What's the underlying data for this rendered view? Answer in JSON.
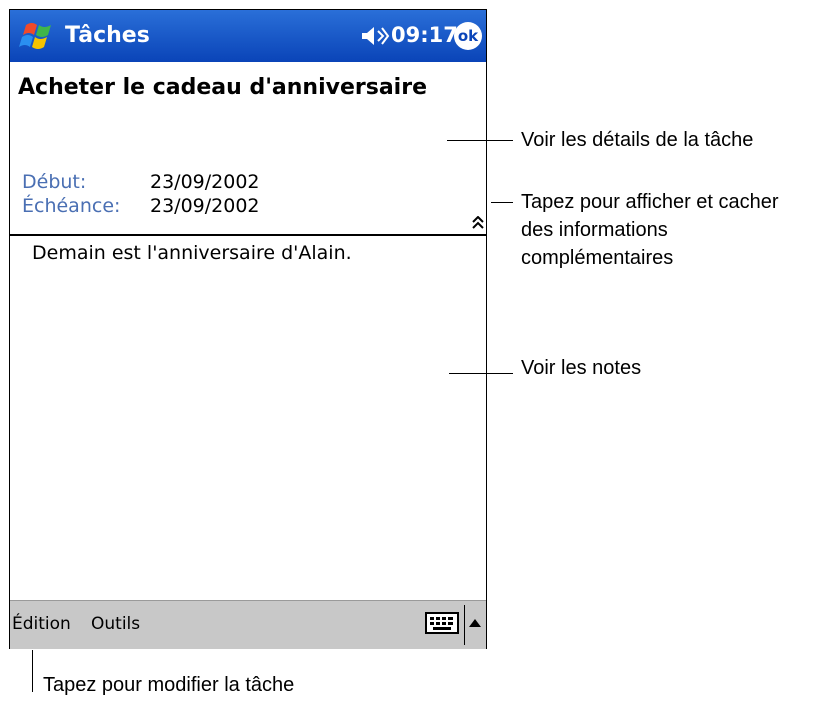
{
  "titlebar": {
    "app_title": "Tâches",
    "time": "09:17",
    "ok_label": "ok",
    "start_icon": "windows-flag-icon",
    "speaker_icon": "speaker-muted-icon"
  },
  "task": {
    "title": "Acheter le cadeau d'anniversaire",
    "start_label": "Début:",
    "start_value": "23/09/2002",
    "due_label": "Échéance:",
    "due_value": "23/09/2002",
    "notes": "Demain est l'anniversaire d'Alain."
  },
  "menubar": {
    "edit_label": "Édition",
    "tools_label": "Outils",
    "keyboard_icon": "keyboard-icon",
    "arrow_icon": "arrow-up-icon"
  },
  "callouts": {
    "details": "Voir les détails de la tâche",
    "toggle": "Tapez pour afficher et cacher des informations complémentaires",
    "notes": "Voir les notes",
    "edit": "Tapez pour modifier la tâche"
  },
  "colors": {
    "titlebar": "#0a44b8",
    "label": "#4a6fb3",
    "menubar": "#c8c8c8"
  }
}
